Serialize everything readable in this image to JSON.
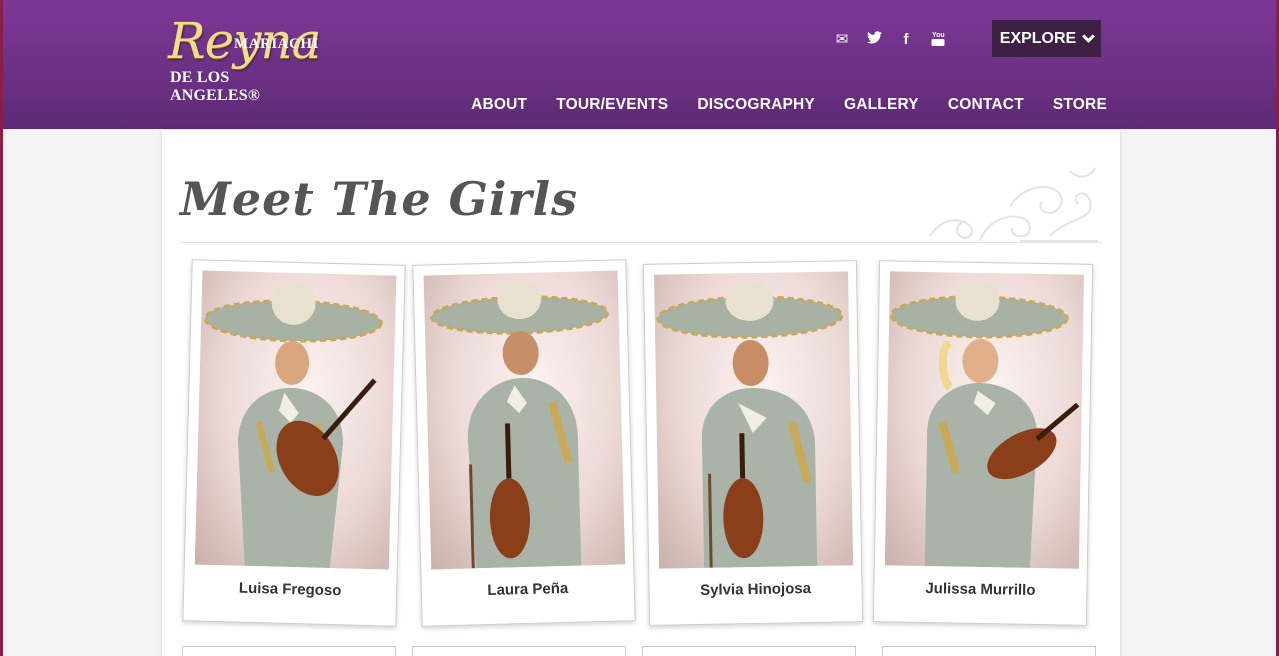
{
  "brand": {
    "script": "Reyna",
    "top": "MARIACHI",
    "bottom": "DE LOS ANGELES®"
  },
  "social": [
    {
      "icon": "email-icon",
      "glyph": "✉"
    },
    {
      "icon": "twitter-icon",
      "glyph": "🐦"
    },
    {
      "icon": "facebook-icon",
      "glyph": "f"
    },
    {
      "icon": "youtube-icon",
      "glyph": "▶"
    }
  ],
  "explore": {
    "label": "EXPLORE"
  },
  "nav": [
    "ABOUT",
    "TOUR/EVENTS",
    "DISCOGRAPHY",
    "GALLERY",
    "CONTACT",
    "STORE"
  ],
  "page": {
    "title": "Meet The Girls"
  },
  "members": [
    {
      "name": "Luisa Fregoso"
    },
    {
      "name": "Laura Peña"
    },
    {
      "name": "Sylvia Hinojosa"
    },
    {
      "name": "Julissa Murrillo"
    }
  ],
  "colors": {
    "header_top": "#7d3897",
    "header_bottom": "#5e2a75",
    "suit": "#a9b3a8",
    "gold": "#c9a957",
    "violin": "#8a3f1a"
  }
}
